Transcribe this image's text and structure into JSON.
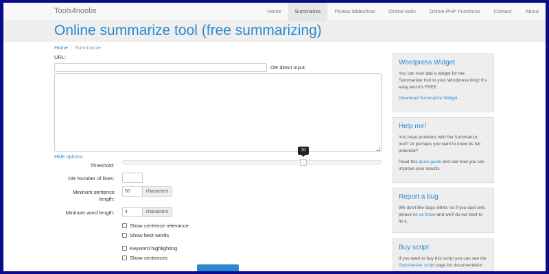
{
  "navbar": {
    "brand": "Tools4noobs",
    "items": [
      {
        "label": "Home"
      },
      {
        "label": "Summarize"
      },
      {
        "label": "Picasa Slideshow"
      },
      {
        "label": "Online tools"
      },
      {
        "label": "Online PHP Functions"
      },
      {
        "label": "Contact"
      },
      {
        "label": "About"
      }
    ],
    "active_index": 1
  },
  "page": {
    "title": "Online summarize tool (free summarizing)"
  },
  "breadcrumb": {
    "home": "Home",
    "current": "Summarize"
  },
  "form": {
    "url_label": "URL:",
    "direct_label": "OR direct input:",
    "hide_options": "Hide options",
    "threshold_label": "Threshold:",
    "threshold_value": "70",
    "lines_label": "OR Number of lines:",
    "min_sentence_label_1": "Mininum sentence",
    "min_sentence_label_2": "length:",
    "min_sentence_value": "50",
    "min_sentence_unit": "characters",
    "min_word_label": "Mininum word length:",
    "min_word_value": "4",
    "min_word_unit": "characters",
    "checkboxes": [
      {
        "label": "Show sentence relevance"
      },
      {
        "label": "Show best words"
      },
      {
        "label": "Keyword highlighting"
      },
      {
        "label": "Show sentences"
      }
    ]
  },
  "sidebar": {
    "wordpress": {
      "title": "Wordpress Widget",
      "text": "You can now add a widget for the Summarizer tool to your Wordpress blog! It's easy and it's FREE.",
      "link": "Download Summarize Widget"
    },
    "help": {
      "title": "Help me!",
      "text": "You have problems with the Summarize tool? Or perhaps you want to know its full potential?",
      "text2_before": "Read this ",
      "text2_link": "quick guide",
      "text2_after": " and see how you can improve your results."
    },
    "bug": {
      "title": "Report a bug",
      "text_before": "We don't like bugs either, so if you spot one, please ",
      "text_link": "let us know",
      "text_after": " and we'll do our best to fix it."
    },
    "buy": {
      "title": "Buy script",
      "text_before": "If you want to buy this script you can see the ",
      "text_link": "Summarizer script",
      "text_after": " page for documentation"
    }
  }
}
